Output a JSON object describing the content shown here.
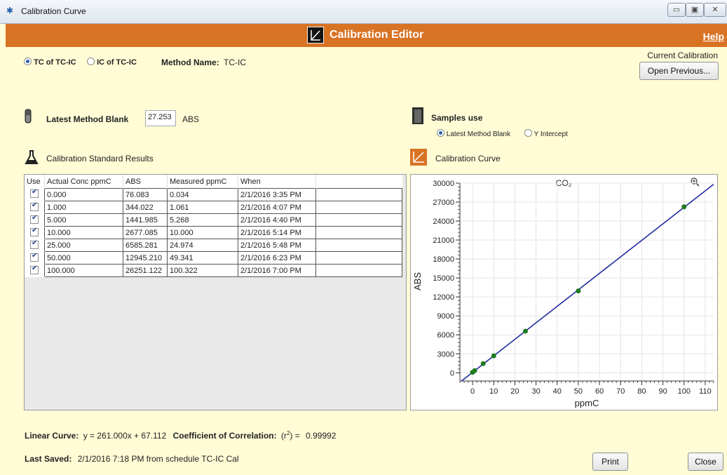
{
  "window": {
    "title": "Calibration Curve",
    "min_label": "▭",
    "max_label": "▣",
    "close_label": "✕"
  },
  "header": {
    "title": "Calibration Editor",
    "help_label": "Help",
    "color": "#d97324"
  },
  "mode": {
    "option1": "TC of TC-IC",
    "option2": "IC of TC-IC",
    "selected": "TC of TC-IC"
  },
  "method": {
    "label": "Method Name:",
    "value": "TC-IC"
  },
  "current_calibration": {
    "label": "Current Calibration",
    "open_previous_label": "Open Previous..."
  },
  "blank": {
    "label": "Latest Method Blank",
    "value": "27.253",
    "unit": "ABS"
  },
  "samples_use": {
    "label": "Samples use",
    "option1": "Latest Method Blank",
    "option2": "Y Intercept",
    "selected": "Latest Method Blank"
  },
  "results": {
    "title": "Calibration Standard Results",
    "columns": [
      "Use",
      "Actual Conc ppmC",
      "ABS",
      "Measured ppmC",
      "When"
    ],
    "rows": [
      {
        "use": true,
        "conc": "0.000",
        "abs": "76.083",
        "measured": "0.034",
        "when": "2/1/2016  3:35 PM"
      },
      {
        "use": true,
        "conc": "1.000",
        "abs": "344.022",
        "measured": "1.061",
        "when": "2/1/2016  4:07 PM"
      },
      {
        "use": true,
        "conc": "5.000",
        "abs": "1441.985",
        "measured": "5.268",
        "when": "2/1/2016  4:40 PM"
      },
      {
        "use": true,
        "conc": "10.000",
        "abs": "2677.085",
        "measured": "10.000",
        "when": "2/1/2016  5:14 PM"
      },
      {
        "use": true,
        "conc": "25.000",
        "abs": "6585.281",
        "measured": "24.974",
        "when": "2/1/2016  5:48 PM"
      },
      {
        "use": true,
        "conc": "50.000",
        "abs": "12945.210",
        "measured": "49.341",
        "when": "2/1/2016  6:23 PM"
      },
      {
        "use": true,
        "conc": "100.000",
        "abs": "26251.122",
        "measured": "100.322",
        "when": "2/1/2016  7:00 PM"
      }
    ]
  },
  "curve_panel": {
    "title": "Calibration Curve"
  },
  "chart_data": {
    "type": "scatter",
    "title": "CO₂",
    "xlabel": "ppmC",
    "ylabel": "ABS",
    "xlim": [
      -6,
      114
    ],
    "ylim": [
      -1300,
      30000
    ],
    "x_ticks": [
      0,
      10,
      20,
      30,
      40,
      50,
      60,
      70,
      80,
      90,
      100,
      110
    ],
    "y_ticks": [
      0,
      3000,
      6000,
      9000,
      12000,
      15000,
      18000,
      21000,
      24000,
      27000,
      30000
    ],
    "x_tick_labels": [
      "0",
      "10",
      "20",
      "30",
      "40",
      "50",
      "60",
      "70",
      "80",
      "90",
      "100",
      "110"
    ],
    "y_tick_labels": [
      "0",
      "3000",
      "6000",
      "9000",
      "12000",
      "15000",
      "18000",
      "21000",
      "24000",
      "27000",
      "30000"
    ],
    "points": [
      {
        "x": 0,
        "y": 76.083
      },
      {
        "x": 1,
        "y": 344.022
      },
      {
        "x": 5,
        "y": 1441.985
      },
      {
        "x": 10,
        "y": 2677.085
      },
      {
        "x": 25,
        "y": 6585.281
      },
      {
        "x": 50,
        "y": 12945.21
      },
      {
        "x": 100,
        "y": 26251.122
      }
    ],
    "fit": {
      "slope": 261.0,
      "intercept": 67.112
    },
    "line_color": "#1f2a9e",
    "point_color": "#1f7a1f",
    "grid": true
  },
  "equation": {
    "linear_label": "Linear Curve:",
    "linear_value": "y = 261.000x + 67.112",
    "corr_label": "Coefficient of Correlation:",
    "r2_value": "0.99992"
  },
  "footer": {
    "last_saved_label": "Last Saved:",
    "last_saved_value": "2/1/2016 7:18 PM from schedule TC-IC Cal",
    "print_label": "Print",
    "close_label": "Close"
  }
}
